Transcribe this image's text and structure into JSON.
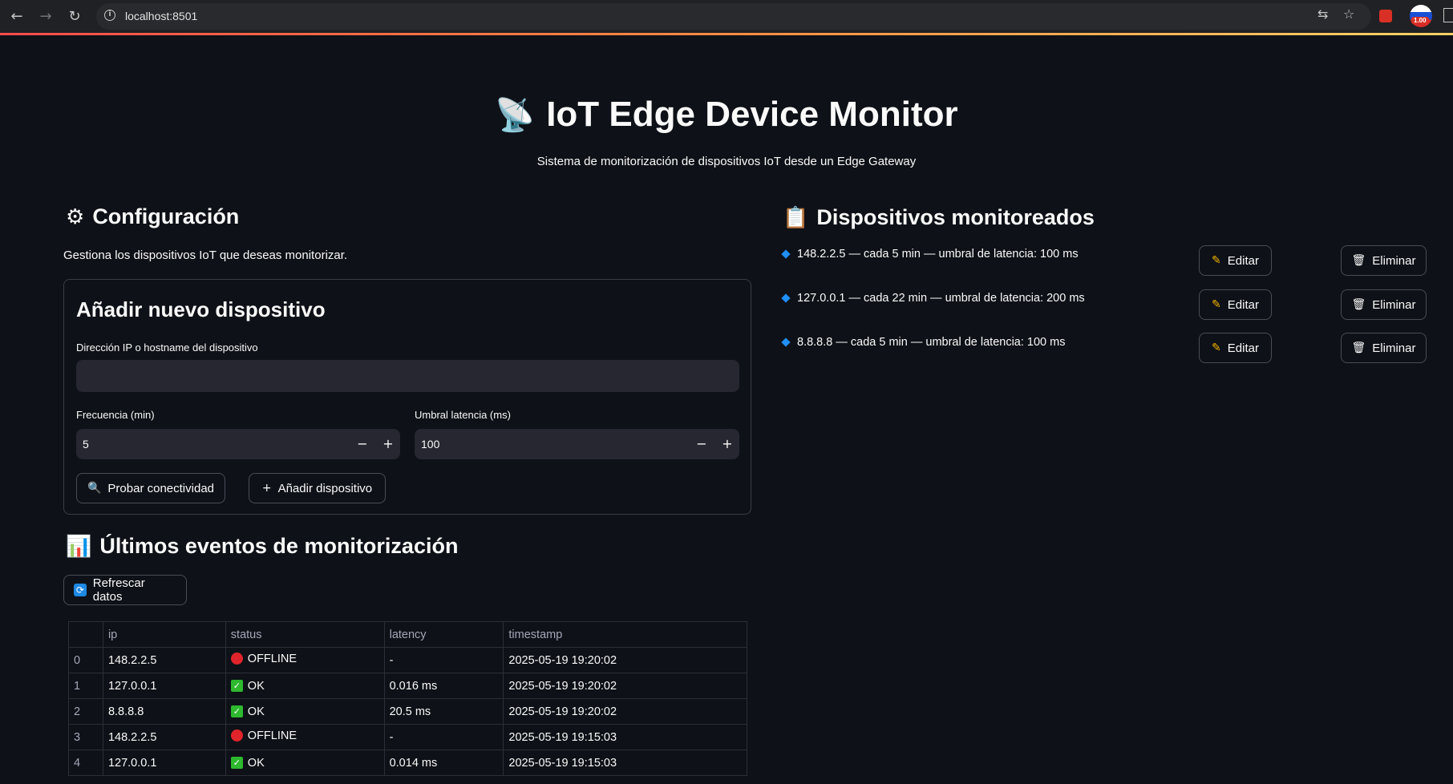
{
  "browser": {
    "url": "localhost:8501",
    "profile_badge": "1.00"
  },
  "header": {
    "icon": "satellite-antenna-icon",
    "title": "IoT Edge Device Monitor",
    "subtitle": "Sistema de monitorización de dispositivos IoT desde un Edge Gateway"
  },
  "config": {
    "icon": "gear-icon",
    "heading": "Configuración",
    "caption": "Gestiona los dispositivos IoT que deseas monitorizar.",
    "form": {
      "title": "Añadir nuevo dispositivo",
      "ip_label": "Dirección IP o hostname del dispositivo",
      "ip_value": "",
      "freq_label": "Frecuencia (min)",
      "freq_value": "5",
      "latency_label": "Umbral latencia (ms)",
      "latency_value": "100",
      "minus": "−",
      "plus": "+",
      "test_button": "Probar conectividad",
      "add_button": "Añadir dispositivo"
    }
  },
  "devices": {
    "icon": "clipboard-icon",
    "heading": "Dispositivos monitoreados",
    "edit_label": "Editar",
    "delete_label": "Eliminar",
    "items": [
      {
        "text": "148.2.2.5 — cada 5 min — umbral de latencia: 100 ms"
      },
      {
        "text": "127.0.0.1 — cada 22 min — umbral de latencia: 200 ms"
      },
      {
        "text": "8.8.8.8 — cada 5 min — umbral de latencia: 100 ms"
      }
    ]
  },
  "events": {
    "icon": "bar-chart-icon",
    "heading": "Últimos eventos de monitorización",
    "refresh_button": "Refrescar datos",
    "columns": [
      "",
      "ip",
      "status",
      "latency",
      "timestamp"
    ],
    "rows": [
      {
        "idx": "0",
        "ip": "148.2.2.5",
        "status": "OFFLINE",
        "latency": "-",
        "timestamp": "2025-05-19 19:20:02"
      },
      {
        "idx": "1",
        "ip": "127.0.0.1",
        "status": "OK",
        "latency": "0.016 ms",
        "timestamp": "2025-05-19 19:20:02"
      },
      {
        "idx": "2",
        "ip": "8.8.8.8",
        "status": "OK",
        "latency": "20.5 ms",
        "timestamp": "2025-05-19 19:20:02"
      },
      {
        "idx": "3",
        "ip": "148.2.2.5",
        "status": "OFFLINE",
        "latency": "-",
        "timestamp": "2025-05-19 19:15:03"
      },
      {
        "idx": "4",
        "ip": "127.0.0.1",
        "status": "OK",
        "latency": "0.014 ms",
        "timestamp": "2025-05-19 19:15:03"
      }
    ]
  }
}
